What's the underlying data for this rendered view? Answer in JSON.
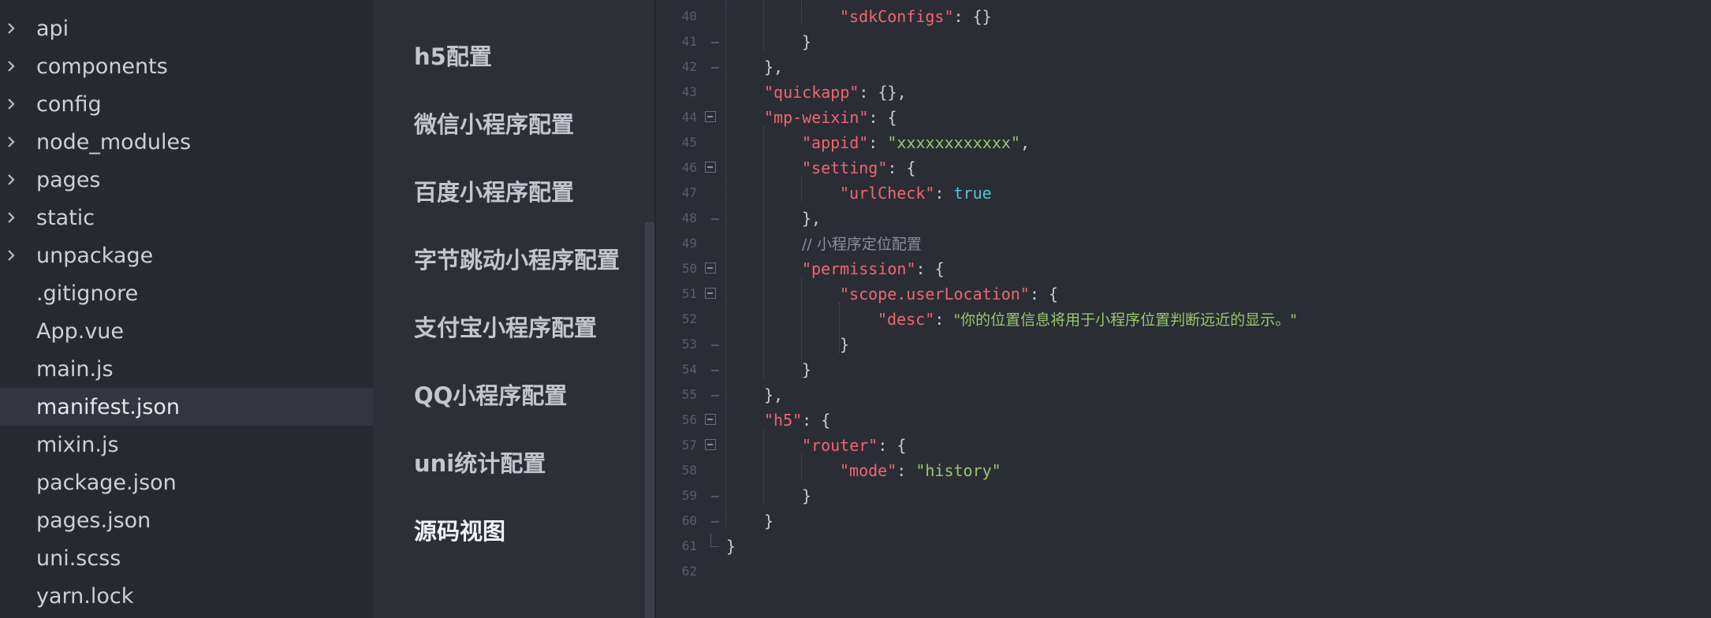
{
  "file_tree": {
    "folders": [
      "api",
      "components",
      "config",
      "node_modules",
      "pages",
      "static",
      "unpackage"
    ],
    "files": [
      ".gitignore",
      "App.vue",
      "main.js",
      "manifest.json",
      "mixin.js",
      "package.json",
      "pages.json",
      "uni.scss",
      "yarn.lock"
    ],
    "active_file": "manifest.json"
  },
  "config_nav": {
    "items": [
      "h5配置",
      "微信小程序配置",
      "百度小程序配置",
      "字节跳动小程序配置",
      "支付宝小程序配置",
      "QQ小程序配置",
      "uni统计配置",
      "源码视图"
    ],
    "active_item": "源码视图"
  },
  "editor": {
    "line_numbers": [
      "40",
      "41",
      "42",
      "43",
      "44",
      "45",
      "46",
      "47",
      "48",
      "49",
      "50",
      "51",
      "52",
      "53",
      "54",
      "55",
      "56",
      "57",
      "58",
      "59",
      "60",
      "61",
      "62"
    ],
    "lines": {
      "l40": {
        "key": "\"sdkConfigs\"",
        "punct": ": {}"
      },
      "l41": {
        "punct": "}"
      },
      "l42": {
        "punct": "},"
      },
      "l43": {
        "key": "\"quickapp\"",
        "punct": ": {},"
      },
      "l44": {
        "key": "\"mp-weixin\"",
        "punct": ": {"
      },
      "l45": {
        "key": "\"appid\"",
        "punct": ": ",
        "value": "\"xxxxxxxxxxxx\"",
        "tail": ","
      },
      "l46": {
        "key": "\"setting\"",
        "punct": ": {"
      },
      "l47": {
        "key": "\"urlCheck\"",
        "punct": ": ",
        "value": "true"
      },
      "l48": {
        "punct": "},"
      },
      "l49": {
        "comment": "// 小程序定位配置"
      },
      "l50": {
        "key": "\"permission\"",
        "punct": ": {"
      },
      "l51": {
        "key": "\"scope.userLocation\"",
        "punct": ": {"
      },
      "l52": {
        "key": "\"desc\"",
        "punct": ": ",
        "value": "\"你的位置信息将用于小程序位置判断远近的显示。\""
      },
      "l53": {
        "punct": "}"
      },
      "l54": {
        "punct": "}"
      },
      "l55": {
        "punct": "},"
      },
      "l56": {
        "key": "\"h5\"",
        "punct": ": {"
      },
      "l57": {
        "key": "\"router\"",
        "punct": ": {"
      },
      "l58": {
        "key": "\"mode\"",
        "punct": ": ",
        "value": "\"history\""
      },
      "l59": {
        "punct": "}"
      },
      "l60": {
        "punct": "}"
      },
      "l61": {
        "punct": "}"
      }
    }
  },
  "colors": {
    "key": "#ef6770",
    "string": "#98c76c",
    "boolean": "#56c2d6",
    "comment": "#8b8f98",
    "background": "#2b2d35"
  }
}
